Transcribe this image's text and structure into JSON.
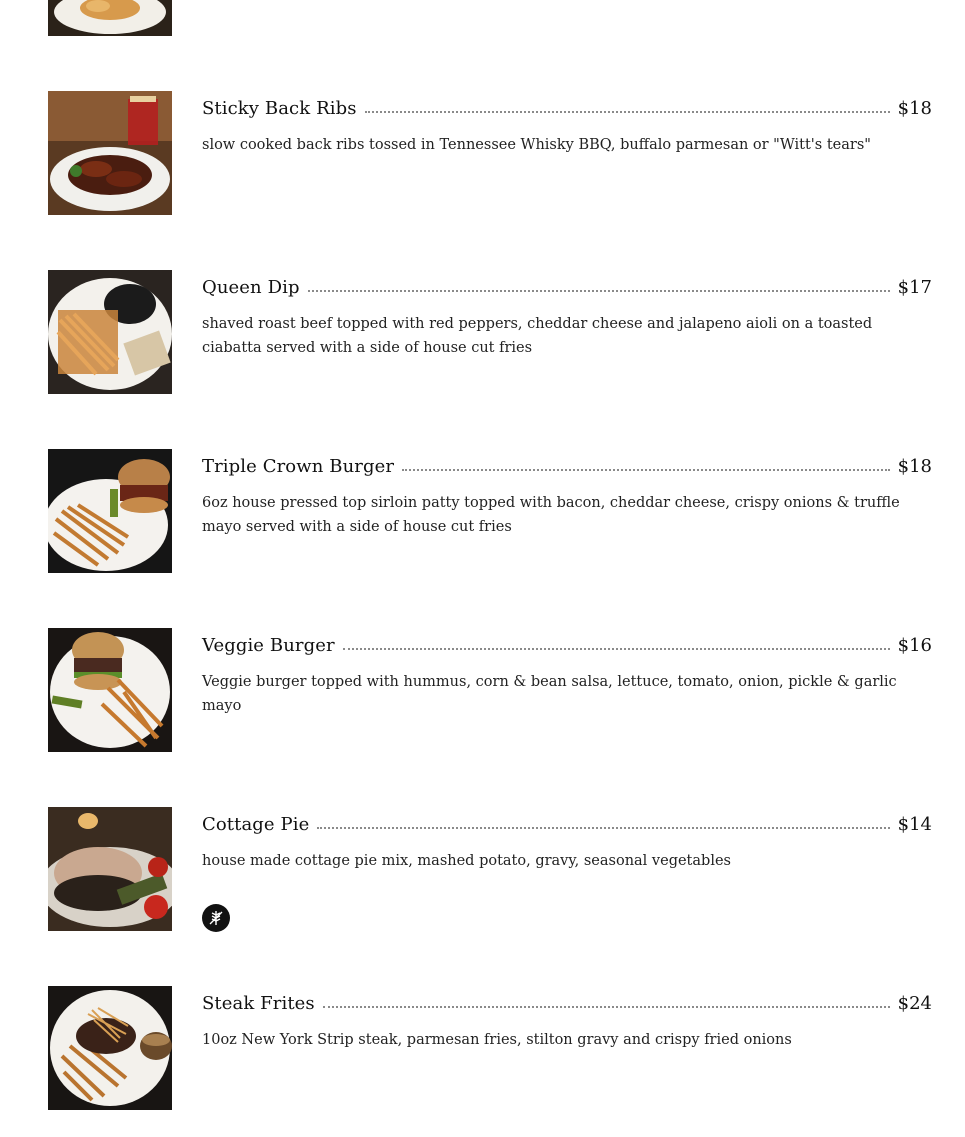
{
  "menu": {
    "items": [
      {
        "name": "Sticky Back Ribs",
        "price": "$18",
        "description": "slow cooked back ribs tossed in Tennessee Whisky BBQ, buffalo parmesan or \"Witt's tears\""
      },
      {
        "name": "Queen Dip",
        "price": "$17",
        "description": "shaved roast beef topped with red peppers, cheddar cheese and jalapeno aioli on a toasted ciabatta served with a side of house cut fries"
      },
      {
        "name": "Triple Crown Burger",
        "price": "$18",
        "description": "6oz house pressed top sirloin patty topped with bacon, cheddar cheese, crispy onions & truffle mayo served with a side of house cut fries"
      },
      {
        "name": "Veggie Burger",
        "price": "$16",
        "description": "Veggie burger topped with hummus, corn & bean salsa, lettuce, tomato, onion, pickle & garlic mayo"
      },
      {
        "name": "Cottage Pie",
        "price": "$14",
        "description": "house made cottage pie mix, mashed potato, gravy, seasonal vegetables",
        "badge_icon": "gluten-free-wheat-icon"
      },
      {
        "name": "Steak Frites",
        "price": "$24",
        "description": "10oz New York Strip steak, parmesan fries, stilton gravy and crispy fried onions"
      }
    ]
  }
}
